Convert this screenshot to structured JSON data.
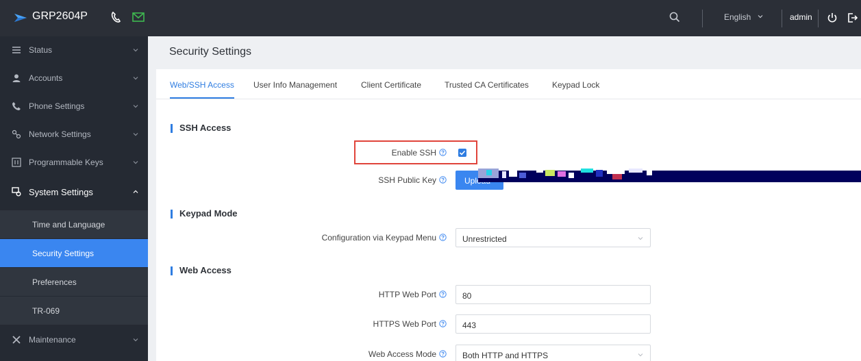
{
  "header": {
    "brand": "GRP2604P",
    "language": "English",
    "user": "admin",
    "icons": [
      "logo-icon",
      "phone-icon",
      "mail-icon",
      "search-icon",
      "chevron-down-icon",
      "power-icon",
      "logout-icon"
    ]
  },
  "sidebar": {
    "items": [
      {
        "label": "Status",
        "icon": "list-icon"
      },
      {
        "label": "Accounts",
        "icon": "user-icon"
      },
      {
        "label": "Phone Settings",
        "icon": "phone-icon"
      },
      {
        "label": "Network Settings",
        "icon": "network-icon"
      },
      {
        "label": "Programmable Keys",
        "icon": "keys-icon"
      },
      {
        "label": "System Settings",
        "icon": "system-icon",
        "expanded": true
      },
      {
        "label": "Maintenance",
        "icon": "tools-icon"
      }
    ],
    "subitems": [
      {
        "label": "Time and Language"
      },
      {
        "label": "Security Settings",
        "active": true
      },
      {
        "label": "Preferences"
      },
      {
        "label": "TR-069"
      }
    ]
  },
  "page": {
    "title": "Security Settings",
    "tabs": [
      {
        "label": "Web/SSH Access",
        "active": true
      },
      {
        "label": "User Info Management"
      },
      {
        "label": "Client Certificate"
      },
      {
        "label": "Trusted CA Certificates"
      },
      {
        "label": "Keypad Lock"
      }
    ]
  },
  "sections": {
    "ssh": {
      "title": "SSH Access",
      "enable_label": "Enable SSH",
      "enable_checked": true,
      "public_key_label": "SSH Public Key",
      "upload_label": "Upload"
    },
    "keypad": {
      "title": "Keypad Mode",
      "config_label": "Configuration via Keypad Menu",
      "config_value": "Unrestricted"
    },
    "web": {
      "title": "Web Access",
      "http_label": "HTTP Web Port",
      "http_value": "80",
      "https_label": "HTTPS Web Port",
      "https_value": "443",
      "mode_label": "Web Access Mode",
      "mode_value": "Both HTTP and HTTPS"
    }
  },
  "colors": {
    "accent": "#3a86f0",
    "sidebar_bg": "#252a33",
    "topbar_bg": "#2b2f37",
    "highlight": "#e0433a"
  }
}
